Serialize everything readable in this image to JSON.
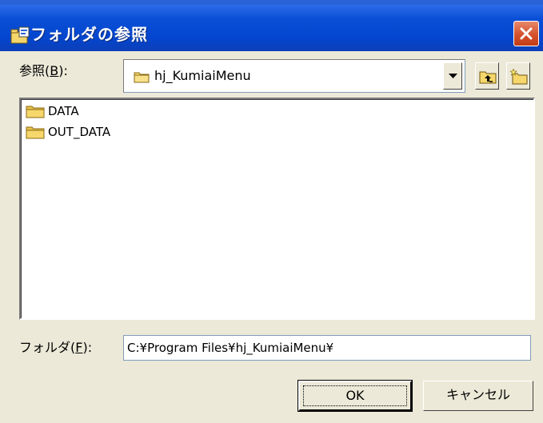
{
  "window": {
    "title": "フォルダの参照",
    "close_label": "×"
  },
  "lookin": {
    "label_prefix": "参照(",
    "label_key": "B",
    "label_suffix": "):",
    "current": "hj_KumiaiMenu"
  },
  "folders": [
    {
      "name": "DATA"
    },
    {
      "name": "OUT_DATA"
    }
  ],
  "folder_field": {
    "label_prefix": "フォルダ(",
    "label_key": "F",
    "label_suffix": "):",
    "value": "C:¥Program Files¥hj_KumiaiMenu¥"
  },
  "buttons": {
    "ok": "OK",
    "cancel": "キャンセル"
  },
  "icons": {
    "title": "folder-browse-icon",
    "up": "up-one-level-icon",
    "new_folder": "new-folder-icon",
    "folder": "folder-icon",
    "dropdown": "chevron-down-icon"
  },
  "colors": {
    "titlebar": "#0a4fd6",
    "close": "#d4512c",
    "dialog_bg": "#ece9d8",
    "folder": "#f6d76c"
  }
}
